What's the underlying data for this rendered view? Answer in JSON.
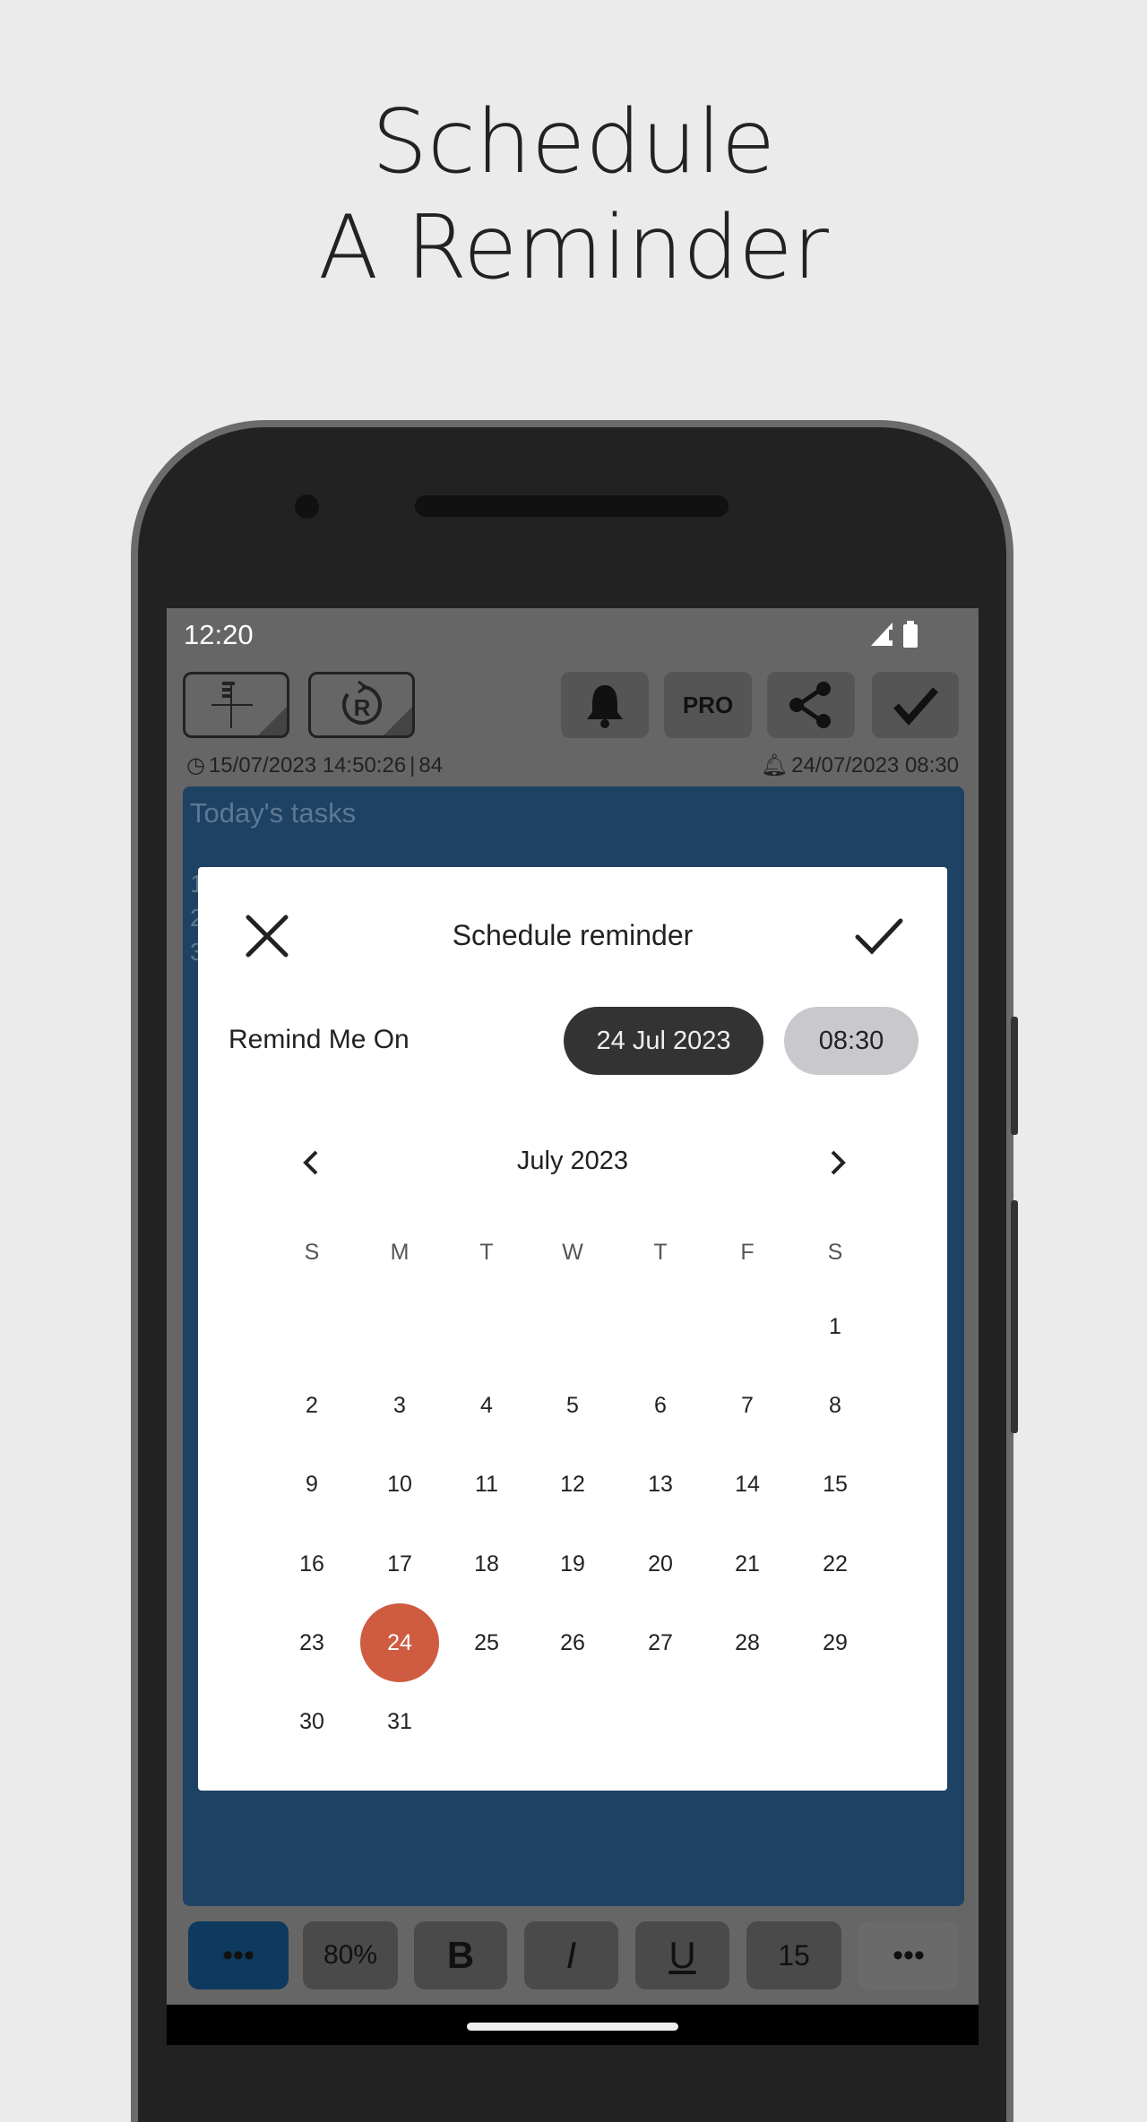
{
  "headline": {
    "line1": "Schedule",
    "line2": "A Reminder"
  },
  "status_bar": {
    "time": "12:20"
  },
  "toolbar": {
    "buttons": [
      "add-note",
      "reminder-r",
      "bell",
      "PRO",
      "share",
      "check"
    ],
    "pro_label": "PRO"
  },
  "info": {
    "created": "15/07/2023 14:50:26",
    "separator": "|",
    "count": "84",
    "reminder": "24/07/2023 08:30"
  },
  "note": {
    "title": "Today's tasks",
    "lines": [
      "1",
      "2",
      "3"
    ],
    "color": "#1e4263"
  },
  "dialog": {
    "title": "Schedule reminder",
    "remind_label": "Remind Me On",
    "date_value": "24 Jul 2023",
    "time_value": "08:30",
    "month_label": "July 2023",
    "weekdays": [
      "S",
      "M",
      "T",
      "W",
      "T",
      "F",
      "S"
    ],
    "first_weekday_index": 6,
    "days_in_month": 31,
    "selected_day": 24,
    "accent": "#cf5b41"
  },
  "bottom_bar": {
    "more_left": "•••",
    "zoom": "80%",
    "bold": "B",
    "italic": "I",
    "underline": "U",
    "font_size": "15",
    "more_right": "•••"
  }
}
